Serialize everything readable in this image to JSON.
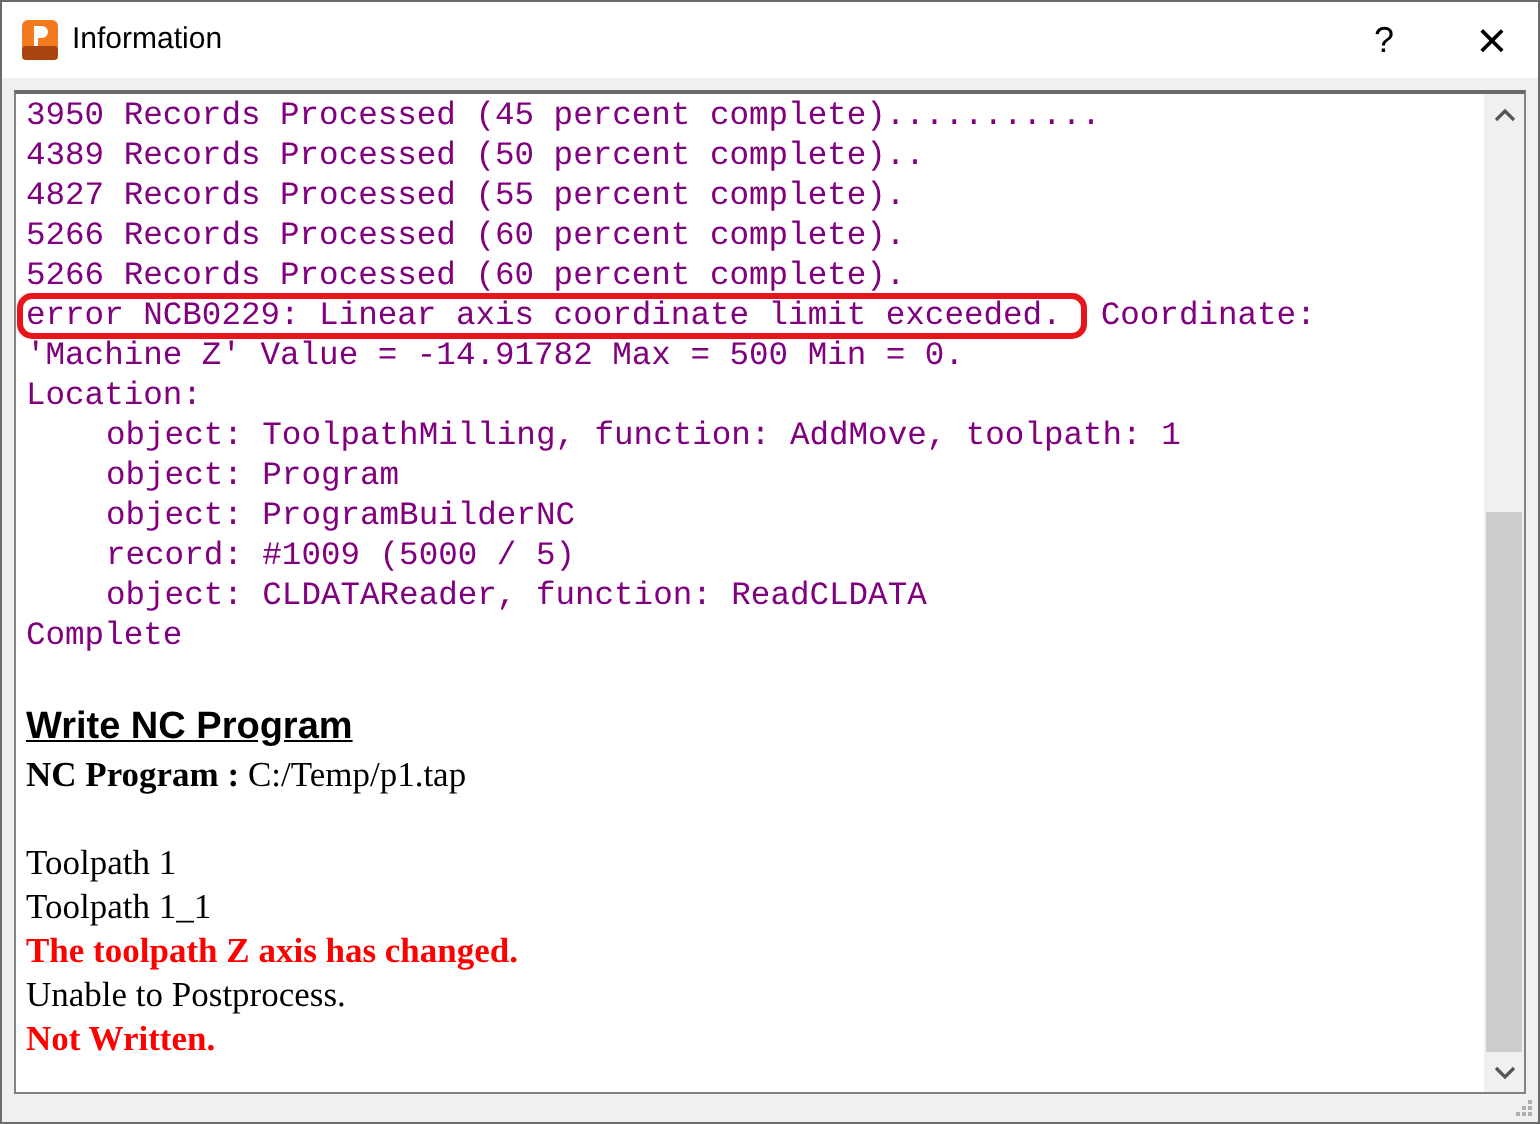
{
  "window": {
    "title": "Information",
    "help_button": "?",
    "close_button": "×"
  },
  "log": [
    {
      "text": "3950 Records Processed (45 percent complete)..........."
    },
    {
      "text": "4389 Records Processed (50 percent complete).."
    },
    {
      "text": "4827 Records Processed (55 percent complete)."
    },
    {
      "text": "5266 Records Processed (60 percent complete)."
    },
    {
      "text": "5266 Records Processed (60 percent complete)."
    },
    {
      "text": "error NCB0229: Linear axis coordinate limit exceeded.  Coordinate:",
      "highlighted": true
    },
    {
      "text": "'Machine Z' Value = -14.91782 Max = 500 Min = 0."
    },
    {
      "text": "Location:",
      "children": [
        {
          "text": "object: ToolpathMilling, function: AddMove, toolpath: 1"
        },
        {
          "text": "object: Program"
        },
        {
          "text": "object: ProgramBuilderNC"
        },
        {
          "text": "record: #1009 (5000 / 5)"
        },
        {
          "text": "object: CLDATAReader, function: ReadCLDATA"
        }
      ]
    },
    {
      "text": "Complete"
    }
  ],
  "report": {
    "heading": "Write NC Program",
    "paragraphs": [
      {
        "lines": [
          {
            "text": "**NC Program :** C:/Temp/p1.tap",
            "kind": "normal"
          }
        ]
      },
      {
        "lines": [
          {
            "text": "Toolpath 1",
            "kind": "normal"
          },
          {
            "text": "Toolpath 1_1",
            "kind": "normal"
          },
          {
            "text": "The toolpath Z axis has changed.",
            "kind": "error"
          },
          {
            "text": "Unable to Postprocess.",
            "kind": "normal"
          },
          {
            "text": "Not Written.",
            "kind": "error"
          }
        ]
      }
    ]
  }
}
